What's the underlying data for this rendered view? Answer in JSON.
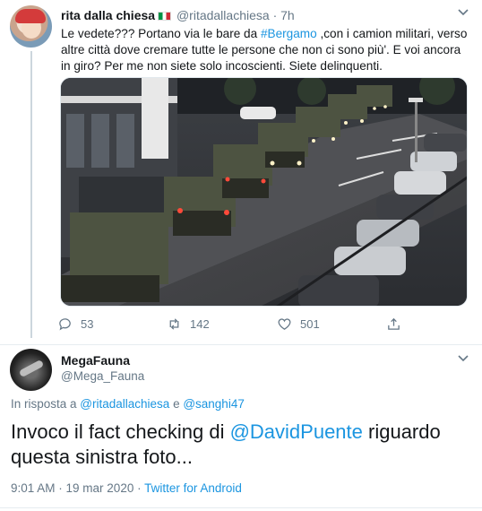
{
  "tweet1": {
    "display_name": "rita dalla chiesa",
    "handle": "@ritadallachiesa",
    "separator": "·",
    "time": "7h",
    "text_before_tag": "Le vedete??? Portano via le bare da ",
    "hashtag": "#Bergamo",
    "text_after_tag": " ,con i camion militari, verso altre città dove cremare tutte le persone che non ci sono più'. E voi ancora in giro? Per me non siete solo incoscienti. Siete delinquenti.",
    "photo_icon": "night-street-military-trucks-photo",
    "replies": "53",
    "retweets": "142",
    "likes": "501"
  },
  "tweet2": {
    "display_name": "MegaFauna",
    "handle": "@Mega_Fauna",
    "reply_prefix": "In risposta a ",
    "reply_user1": "@ritadallachiesa",
    "reply_and": " e ",
    "reply_user2": "@sanghi47",
    "text_before_mention": "Invoco il fact checking di ",
    "mention": "@DavidPuente",
    "text_after_mention": " riguardo questa sinistra foto...",
    "time": "9:01 AM",
    "date_sep": " · ",
    "date": "19 mar 2020",
    "source_sep": " · ",
    "source": "Twitter for Android"
  },
  "colors": {
    "link": "#1b95e0",
    "secondary_text": "#657786",
    "divider": "#e6ecf0"
  },
  "icons": {
    "reply": "reply-icon",
    "retweet": "retweet-icon",
    "like": "heart-icon",
    "share": "share-icon",
    "more": "chevron-down-icon"
  }
}
